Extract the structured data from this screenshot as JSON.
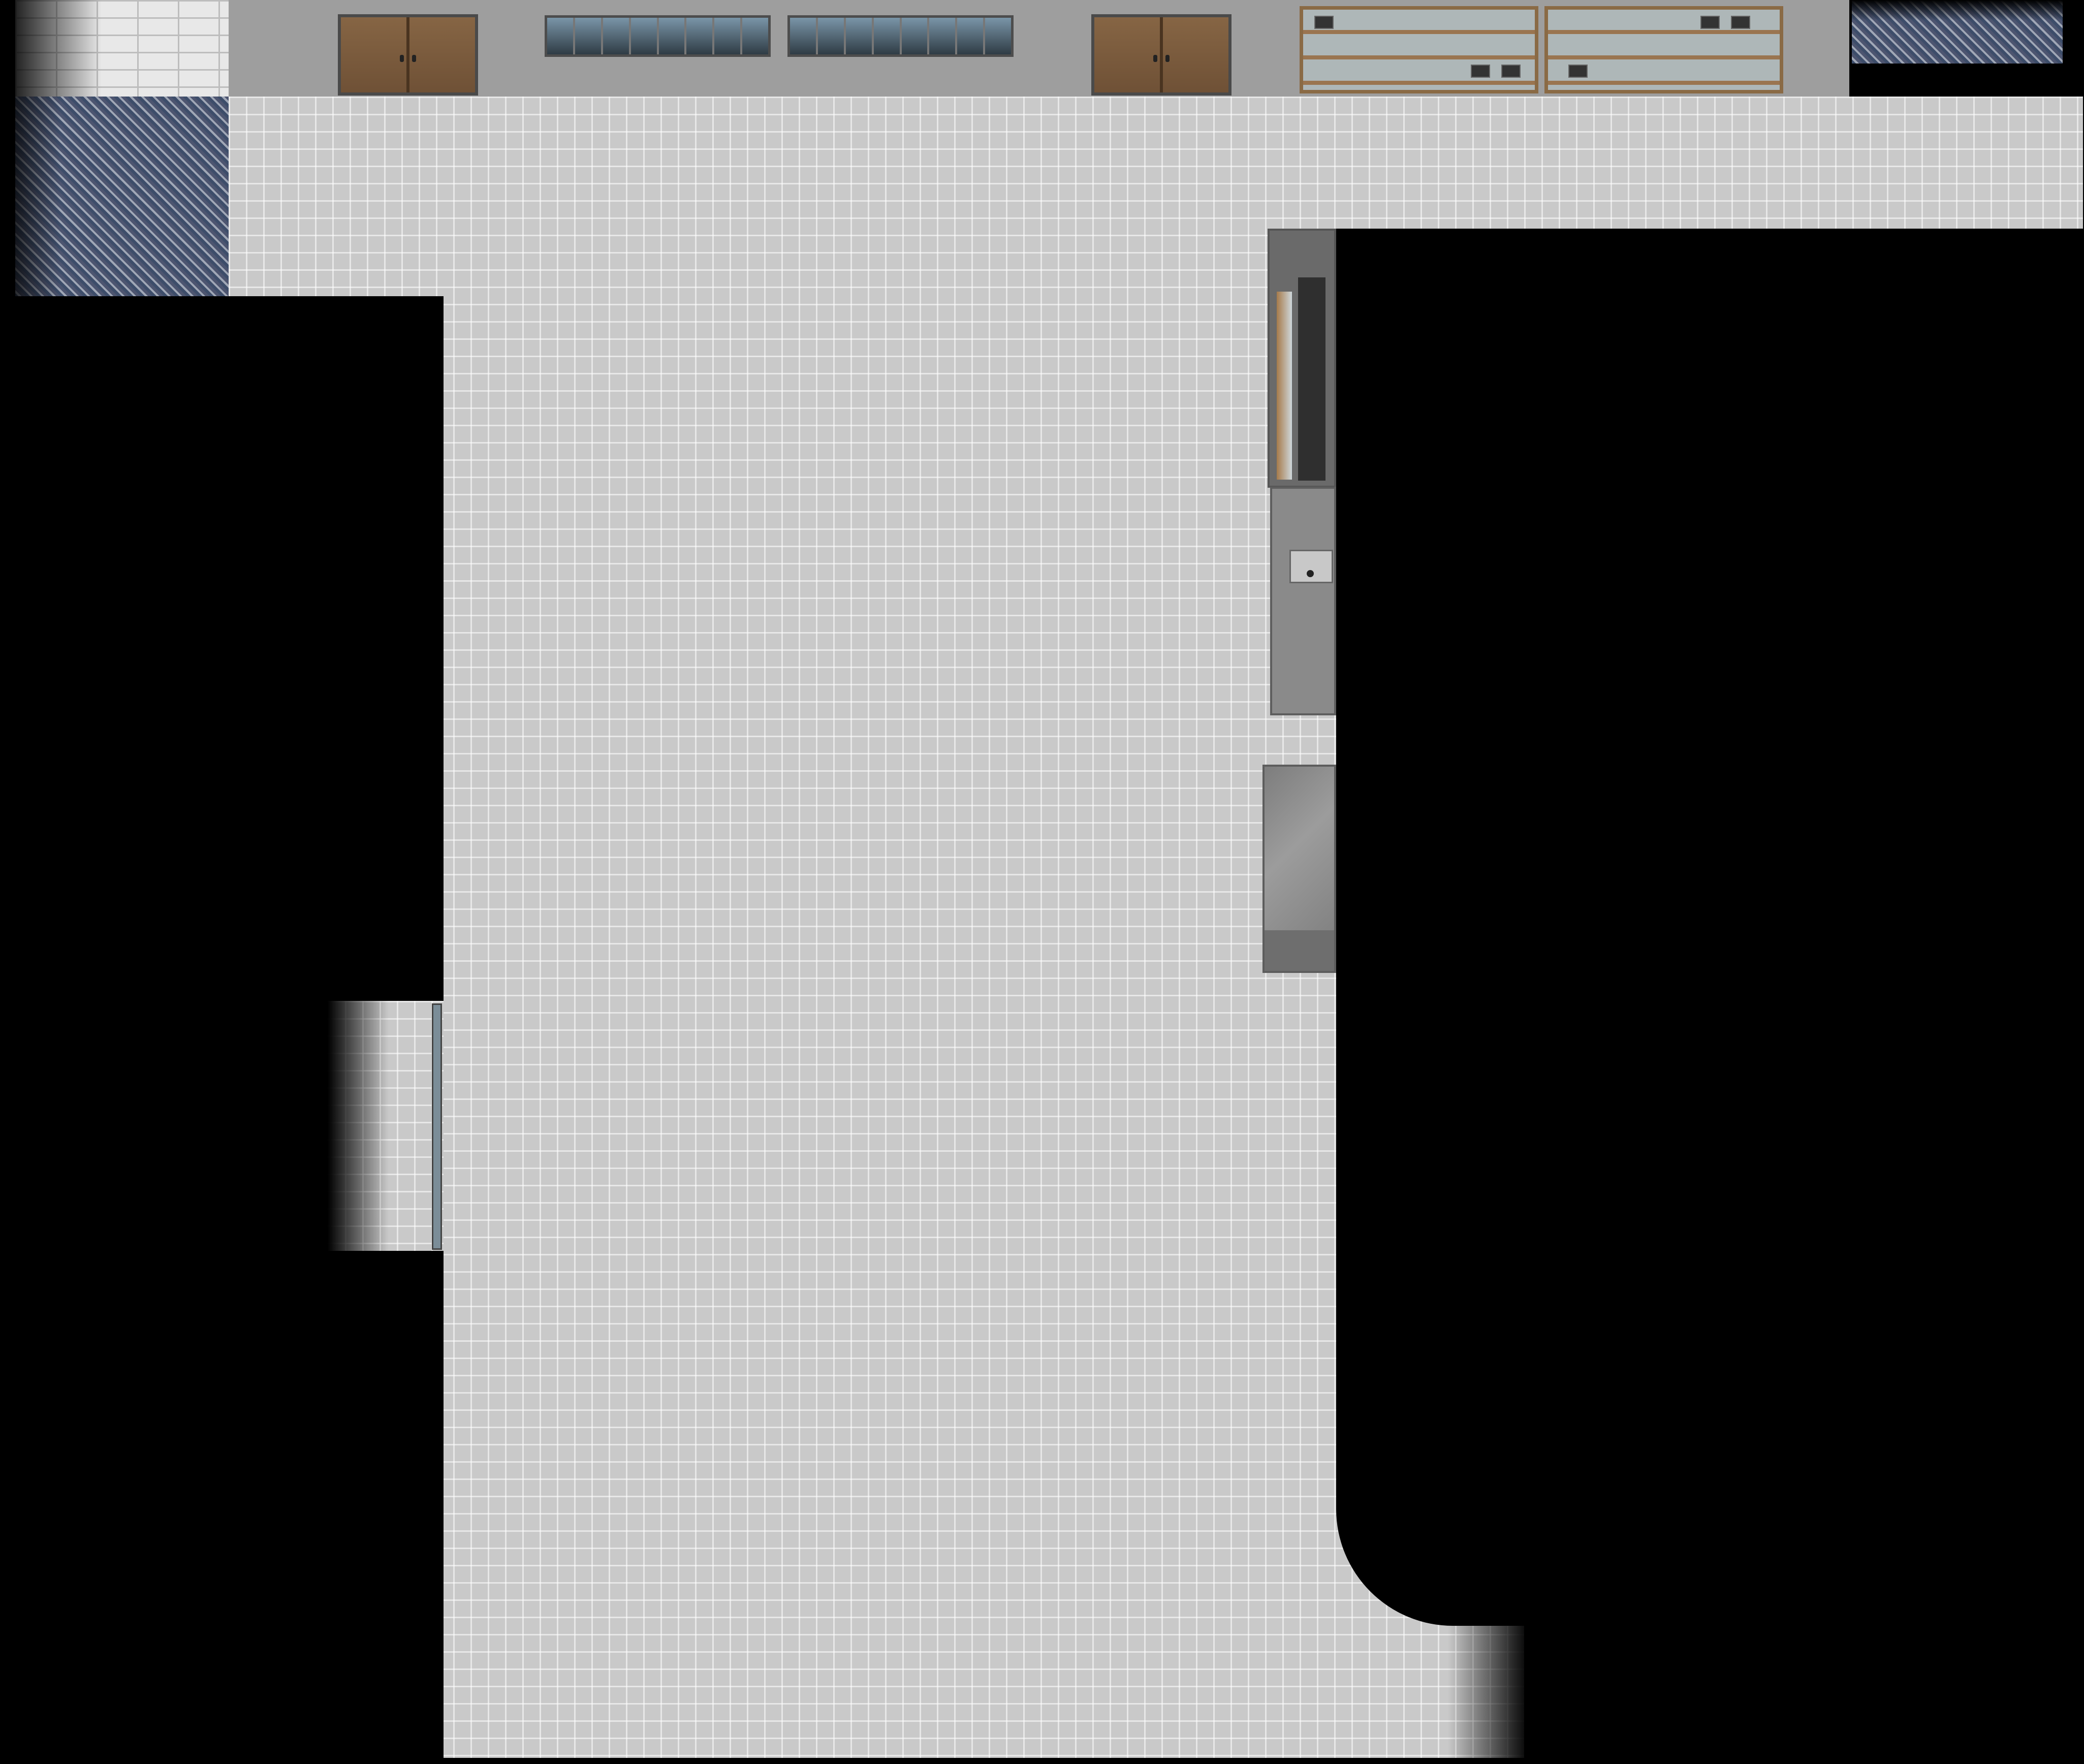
{
  "scene": {
    "type": "top-down interior map",
    "colors": {
      "floor": "#c9c9c9",
      "wall": "#9e9e9e",
      "void": "#000000",
      "door_wood": "#7a5a3a",
      "cabinet_frame": "#8a6a45",
      "window_glass": "#4a5c68"
    },
    "objects": {
      "doors": [
        "double-door-left",
        "double-door-right"
      ],
      "windows": [
        "window-left",
        "window-right"
      ],
      "cabinets": [
        "trophy-cabinet-left",
        "trophy-cabinet-right"
      ],
      "furniture": [
        "bookshelf",
        "sink-counter",
        "metal-table",
        "side-door"
      ]
    }
  }
}
